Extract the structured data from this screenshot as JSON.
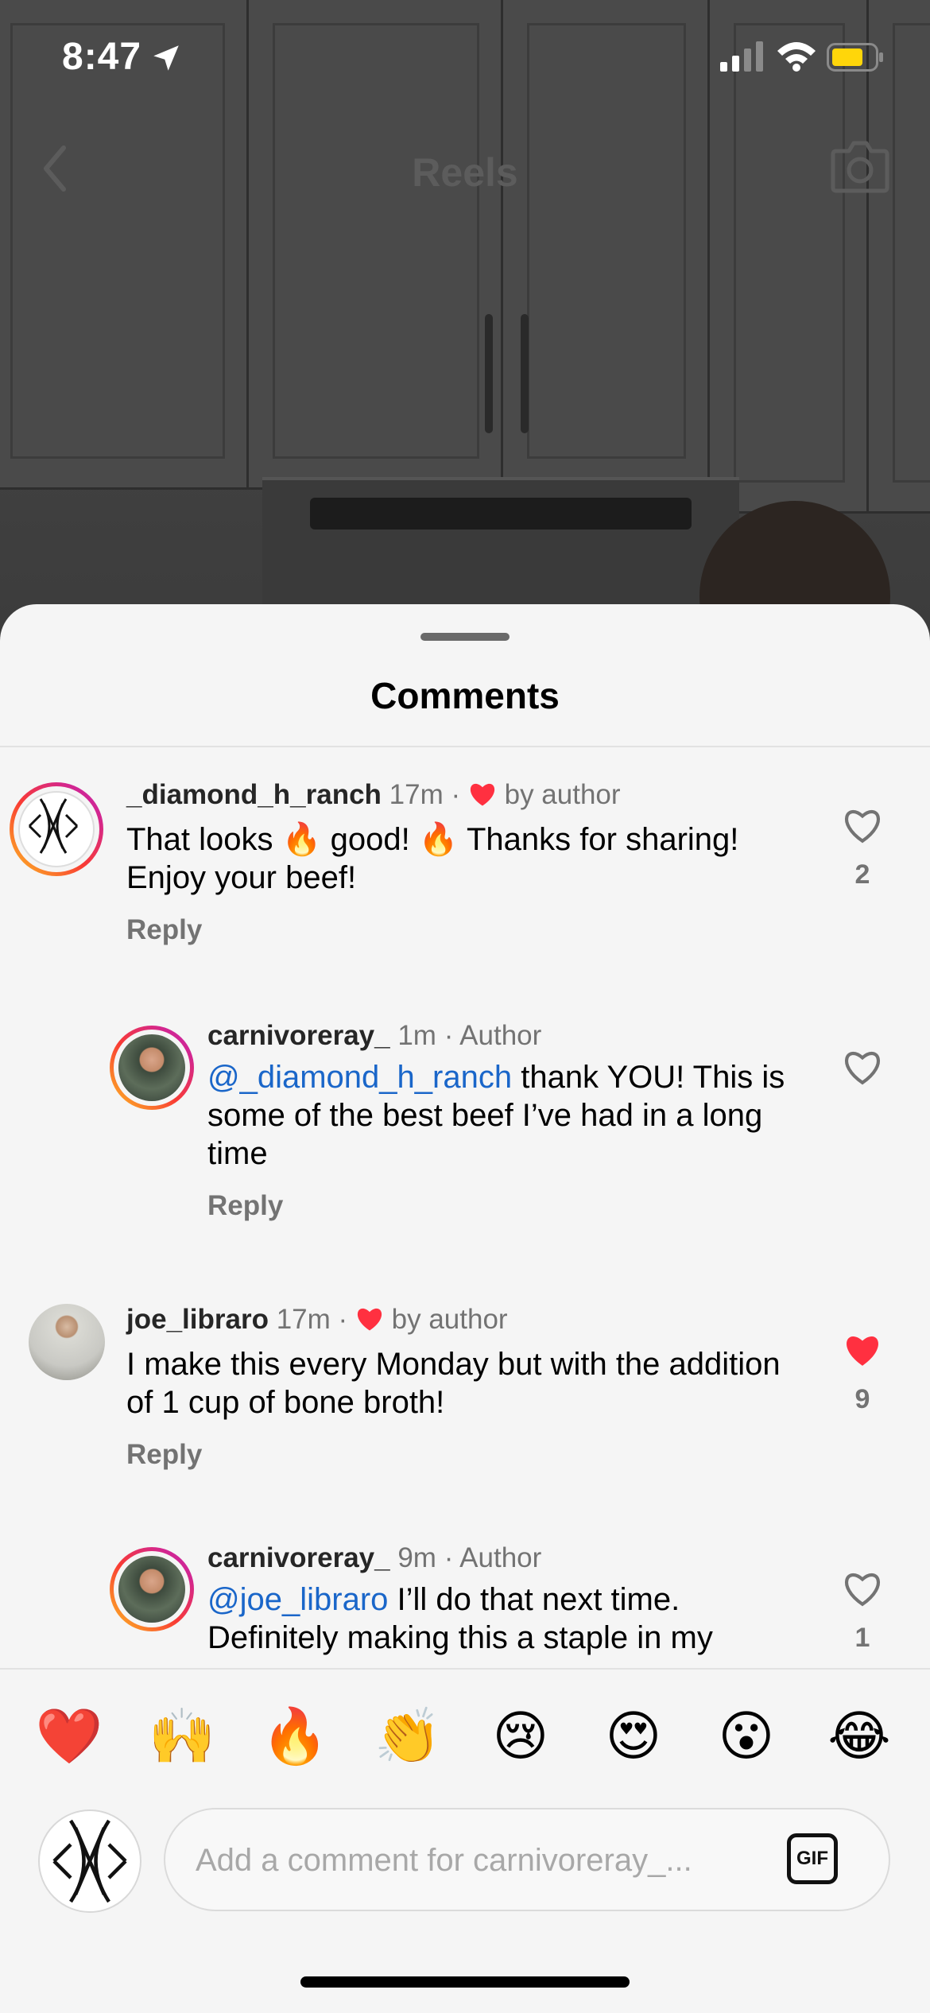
{
  "status_bar": {
    "time": "8:47"
  },
  "top_nav": {
    "title": "Reels"
  },
  "sheet": {
    "title": "Comments"
  },
  "comments": [
    {
      "username": "_diamond_h_ranch",
      "time": "17m",
      "meta_separator": "·",
      "badge": "by author",
      "text_part1": "That looks ",
      "emoji1": "🔥",
      "text_part2": " good! ",
      "emoji2": "🔥",
      "text_part3": " Thanks for sharing! Enjoy your beef!",
      "reply": "Reply",
      "likes": "2",
      "liked": false
    },
    {
      "username": "carnivoreray_",
      "time": "1m",
      "meta_separator": "·",
      "badge": "Author",
      "mention": "@_diamond_h_ranch",
      "text": " thank YOU! This is some of the best beef I’ve had in a long time",
      "reply": "Reply",
      "likes": "",
      "liked": false
    },
    {
      "username": "joe_libraro",
      "time": "17m",
      "meta_separator": "·",
      "badge": "by author",
      "text": "I make this every Monday but with the addition of 1 cup of bone broth!",
      "reply": "Reply",
      "likes": "9",
      "liked": true
    },
    {
      "username": "carnivoreray_",
      "time": "9m",
      "meta_separator": "·",
      "badge": "Author",
      "mention": "@joe_libraro",
      "text": " I’ll do that next time. Definitely making this a staple in my",
      "likes": "1",
      "liked": false
    }
  ],
  "emoji_bar": [
    "❤️",
    "🙌",
    "🔥",
    "👏",
    "😢",
    "😍",
    "😮",
    "😂"
  ],
  "composer": {
    "placeholder": "Add a comment for carnivoreray_...",
    "gif_label": "GIF"
  },
  "colors": {
    "mention": "#1a66c9",
    "like_red": "#ff3040",
    "battery": "#ffd60a"
  },
  "icons": [
    "location-arrow-icon",
    "signal-icon",
    "wifi-icon",
    "battery-icon",
    "back-chevron-icon",
    "camera-icon",
    "heart-icon",
    "gif-icon"
  ]
}
